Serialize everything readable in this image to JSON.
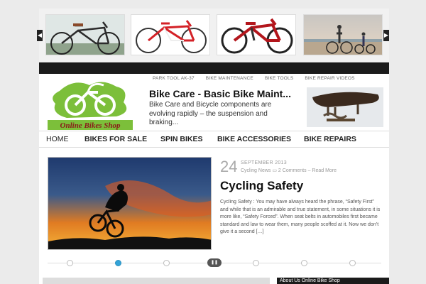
{
  "carousel": {
    "prev_icon": "chevron-left-icon",
    "next_icon": "chevron-right-icon",
    "items": [
      {
        "alt": "cruiser-bike"
      },
      {
        "alt": "road-bike"
      },
      {
        "alt": "mountain-bike"
      },
      {
        "alt": "beach-bikes"
      }
    ]
  },
  "logo": {
    "text": "Online Bikes Shop",
    "brand_color": "#7cbf3a"
  },
  "top_links": [
    "PARK TOOL AK-37",
    "BIKE MAINTENANCE",
    "BIKE TOOLS",
    "BIKE REPAIR VIDEOS"
  ],
  "headline": {
    "title": "Bike Care - Basic Bike Maint...",
    "excerpt": "Bike Care and Bicycle components are evolving rapidly – the suspension and braking..."
  },
  "nav": [
    "HOME",
    "BIKES FOR SALE",
    "SPIN BIKES",
    "BIKE ACCESSORIES",
    "BIKE REPAIRS"
  ],
  "feature": {
    "day": "24",
    "month": "SEPTEMBER 2013",
    "category": "Cycling News",
    "comments": "2 Comments",
    "read_more": "Read More",
    "title": "Cycling Safety",
    "excerpt": "Cycling Safety : You may have always heard the phrase, “Safety First” and while that is an admirable and true statement, in some situations it is more like, “Safety Forced”. When seat belts in automobiles first became standard and law to wear them, many people scoffed at it. Now we don’t give it a second […]"
  },
  "slider": {
    "active_index": 1,
    "play_label": "❚❚",
    "accent": "#33a3d8"
  },
  "widget": {
    "title": "About Us Online Bike Shop"
  }
}
